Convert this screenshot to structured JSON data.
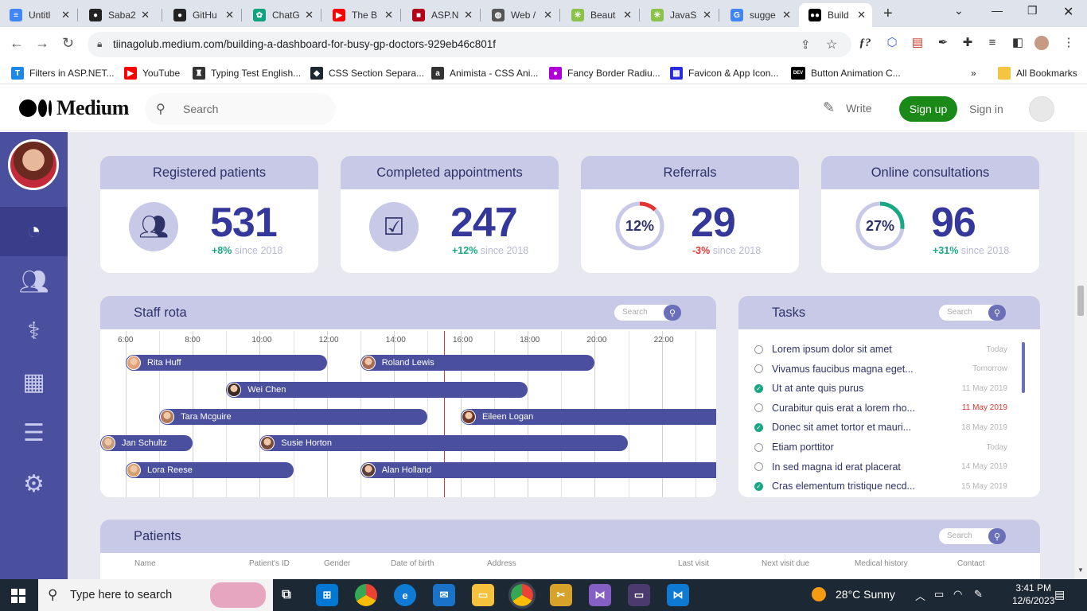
{
  "browser": {
    "tabs": [
      {
        "title": "Untitl",
        "icon": "docs-icon",
        "color": "#4285f4",
        "glyph": "≡"
      },
      {
        "title": "Saba2",
        "icon": "github-icon",
        "color": "#222",
        "glyph": "●"
      },
      {
        "title": "GitHu",
        "icon": "github-icon",
        "color": "#222",
        "glyph": "●"
      },
      {
        "title": "ChatG",
        "icon": "chatgpt-icon",
        "color": "#10a37f",
        "glyph": "✿"
      },
      {
        "title": "The B",
        "icon": "youtube-icon",
        "color": "#ff0000",
        "glyph": "▶"
      },
      {
        "title": "ASP.N",
        "icon": "asp-icon",
        "color": "#b3001b",
        "glyph": "■"
      },
      {
        "title": "Web /",
        "icon": "globe-icon",
        "color": "#555",
        "glyph": "◍"
      },
      {
        "title": "Beaut",
        "icon": "swirl-icon",
        "color": "#8bc34a",
        "glyph": "✳"
      },
      {
        "title": "JavaS",
        "icon": "swirl-icon",
        "color": "#8bc34a",
        "glyph": "✳"
      },
      {
        "title": "sugge",
        "icon": "google-icon",
        "color": "#4285f4",
        "glyph": "G"
      },
      {
        "title": "Build",
        "icon": "medium-icon",
        "color": "#000",
        "glyph": "●●",
        "active": true
      }
    ],
    "url": "tiinagolub.medium.com/building-a-dashboard-for-busy-gp-doctors-929eb46c801f",
    "bookmarks": [
      {
        "label": "Filters in ASP.NET...",
        "icon": "t-icon",
        "color": "#1e88e5",
        "glyph": "T"
      },
      {
        "label": "YouTube",
        "icon": "youtube-icon",
        "color": "#ff0000",
        "glyph": "▶"
      },
      {
        "label": "Typing Test English...",
        "icon": "typing-icon",
        "color": "#333",
        "glyph": "♜"
      },
      {
        "label": "CSS Section Separa...",
        "icon": "css-icon",
        "color": "#1c2833",
        "glyph": "◆"
      },
      {
        "label": "Animista - CSS Ani...",
        "icon": "animista-icon",
        "color": "#333",
        "glyph": "a"
      },
      {
        "label": "Fancy Border Radiu...",
        "icon": "blob-icon",
        "color": "#b000d8",
        "glyph": "●"
      },
      {
        "label": "Favicon & App Icon...",
        "icon": "favicon-icon",
        "color": "#2a2ae0",
        "glyph": "▦"
      },
      {
        "label": "Button Animation C...",
        "icon": "dev-icon",
        "color": "#000",
        "glyph": "DEV"
      }
    ],
    "all_bookmarks": "All Bookmarks",
    "ext_label": "ƒ?"
  },
  "medium": {
    "brand": "Medium",
    "search_placeholder": "Search",
    "write": "Write",
    "signup": "Sign up",
    "signin": "Sign in"
  },
  "dashboard": {
    "cards": [
      {
        "title": "Registered patients",
        "value": "531",
        "change": "+8%",
        "since": " since 2018",
        "change_color": "#1aa784",
        "kind": "icon",
        "icon": "users-icon"
      },
      {
        "title": "Completed appointments",
        "value": "247",
        "change": "+12%",
        "since": " since 2018",
        "change_color": "#1aa784",
        "kind": "icon",
        "icon": "calendar-check-icon"
      },
      {
        "title": "Referrals",
        "value": "29",
        "change": "-3%",
        "since": " since 2018",
        "change_color": "#e3342f",
        "kind": "ring",
        "pct": "12%",
        "fraction": 0.12,
        "ring_color": "#e3342f"
      },
      {
        "title": "Online consultations",
        "value": "96",
        "change": "+31%",
        "since": " since 2018",
        "change_color": "#1aa784",
        "kind": "ring",
        "pct": "27%",
        "fraction": 0.27,
        "ring_color": "#1aa784"
      }
    ],
    "rota": {
      "title": "Staff rota",
      "search_placeholder": "Search",
      "hours": [
        "6:00",
        "8:00",
        "10:00",
        "12:00",
        "14:00",
        "16:00",
        "18:00",
        "20:00",
        "22:00"
      ],
      "now": "15:30",
      "shifts": [
        {
          "name": "Rita Huff",
          "start": "6:00",
          "end": "12:00",
          "row": 0
        },
        {
          "name": "Roland Lewis",
          "start": "13:00",
          "end": "20:00",
          "row": 0
        },
        {
          "name": "Wei Chen",
          "start": "9:00",
          "end": "18:00",
          "row": 1
        },
        {
          "name": "Tara Mcguire",
          "start": "7:00",
          "end": "15:00",
          "row": 2
        },
        {
          "name": "Eileen Logan",
          "start": "16:00",
          "end": "24:00",
          "row": 2
        },
        {
          "name": "Jan Schultz",
          "start": "5:00",
          "end": "8:00",
          "row": 3
        },
        {
          "name": "Susie Horton",
          "start": "10:00",
          "end": "21:00",
          "row": 3
        },
        {
          "name": "Lora Reese",
          "start": "6:00",
          "end": "11:00",
          "row": 4
        },
        {
          "name": "Alan Holland",
          "start": "13:00",
          "end": "24:00",
          "row": 4
        }
      ]
    },
    "tasks": {
      "title": "Tasks",
      "search_placeholder": "Search",
      "items": [
        {
          "text": "Lorem ipsum dolor sit amet",
          "date": "Today",
          "done": false,
          "overdue": false
        },
        {
          "text": "Vivamus faucibus magna eget...",
          "date": "Tomorrow",
          "done": false,
          "overdue": false
        },
        {
          "text": "Ut at ante quis purus",
          "date": "11 May 2019",
          "done": true,
          "overdue": false
        },
        {
          "text": "Curabitur quis erat a lorem rho...",
          "date": "11 May 2019",
          "done": false,
          "overdue": true
        },
        {
          "text": "Donec sit amet tortor et mauri...",
          "date": "18 May 2019",
          "done": true,
          "overdue": false
        },
        {
          "text": "Etiam porttitor",
          "date": "Today",
          "done": false,
          "overdue": false
        },
        {
          "text": "In sed magna id erat placerat",
          "date": "14 May 2019",
          "done": false,
          "overdue": false
        },
        {
          "text": "Cras elementum tristique necd...",
          "date": "15 May 2019",
          "done": true,
          "overdue": false
        }
      ]
    },
    "patients": {
      "title": "Patients",
      "search_placeholder": "Search",
      "columns": [
        "Name",
        "Patient's ID",
        "Gender",
        "Date of birth",
        "Address",
        "Last visit",
        "Next visit due",
        "Medical history",
        "Contact"
      ]
    }
  },
  "taskbar": {
    "search_placeholder": "Type here to search",
    "weather": "28°C  Sunny",
    "time": "3:41 PM",
    "date": "12/6/2023"
  }
}
